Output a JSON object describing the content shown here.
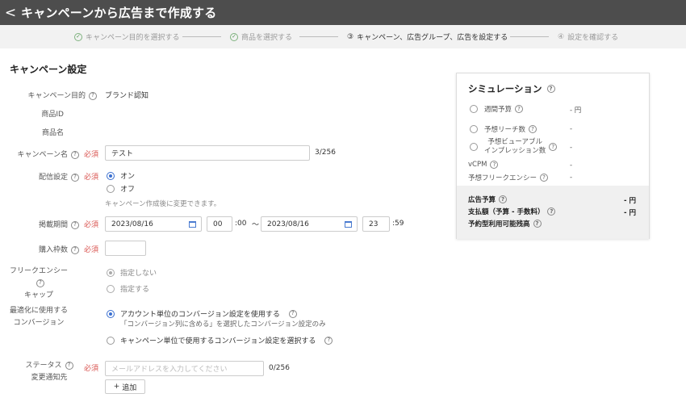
{
  "header": {
    "back_glyph": "<",
    "title": "キャンペーンから広告まで作成する"
  },
  "steps": [
    {
      "label": "キャンペーン目的を選択する",
      "state": "done"
    },
    {
      "label": "商品を選択する",
      "state": "done"
    },
    {
      "num": "③",
      "label": "キャンペーン、広告グループ、広告を設定する",
      "state": "current"
    },
    {
      "num": "④",
      "label": "設定を確認する",
      "state": "pending"
    }
  ],
  "section_title": "キャンペーン設定",
  "required_label": "必須",
  "form": {
    "objective": {
      "label": "キャンペーン目的",
      "value": "ブランド認知"
    },
    "product_id": {
      "label": "商品ID"
    },
    "product_name": {
      "label": "商品名"
    },
    "campaign_name": {
      "label": "キャンペーン名",
      "value": "テスト",
      "counter": "3/256"
    },
    "delivery": {
      "label": "配信設定",
      "on": "オン",
      "off": "オフ",
      "note": "キャンペーン作成後に変更できます。"
    },
    "period": {
      "label": "掲載期間",
      "start_date": "2023/08/16",
      "start_hour": "00",
      "start_min": ":00",
      "tilde": "〜",
      "end_date": "2023/08/16",
      "end_hour": "23",
      "end_min": ":59"
    },
    "slots": {
      "label": "購入枠数",
      "value": ""
    },
    "frequency_cap": {
      "label_line1": "フリークエンシー",
      "label_line2": "キャップ",
      "opt1": "指定しない",
      "opt2": "指定する"
    },
    "conversion": {
      "label_line1": "最適化に使用する",
      "label_line2": "コンバージョン",
      "opt1": "アカウント単位のコンバージョン設定を使用する",
      "opt1_sub": "「コンバージョン列に含める」を選択したコンバージョン設定のみ",
      "opt2": "キャンペーン単位で使用するコンバージョン設定を選択する"
    },
    "status_notify": {
      "label_line1": "ステータス",
      "label_line2": "変更通知先",
      "placeholder": "メールアドレスを入力してください",
      "counter": "0/256",
      "add_label": "追加",
      "add_glyph": "+"
    }
  },
  "simulation": {
    "title": "シミュレーション",
    "rows": [
      {
        "label": "週間予算",
        "value": "- 円"
      },
      {
        "label": "予想リーチ数",
        "value": "-"
      },
      {
        "label_line1": "予想ビューアブル",
        "label_line2": "インプレッション数",
        "value": "-"
      },
      {
        "label": "vCPM",
        "value": "-"
      },
      {
        "label": "予想フリークエンシー",
        "value": "-"
      }
    ],
    "footer": [
      {
        "label": "広告予算",
        "value": "- 円"
      },
      {
        "label": "支払額（予算 - 手数料）",
        "value": "- 円"
      },
      {
        "label": "予約型利用可能残高",
        "value": ""
      }
    ]
  },
  "colors": {
    "header_bg": "#4d4d4d",
    "accent": "#3a6fd0",
    "required": "#d9534f",
    "step_done": "#5a9e5a"
  }
}
